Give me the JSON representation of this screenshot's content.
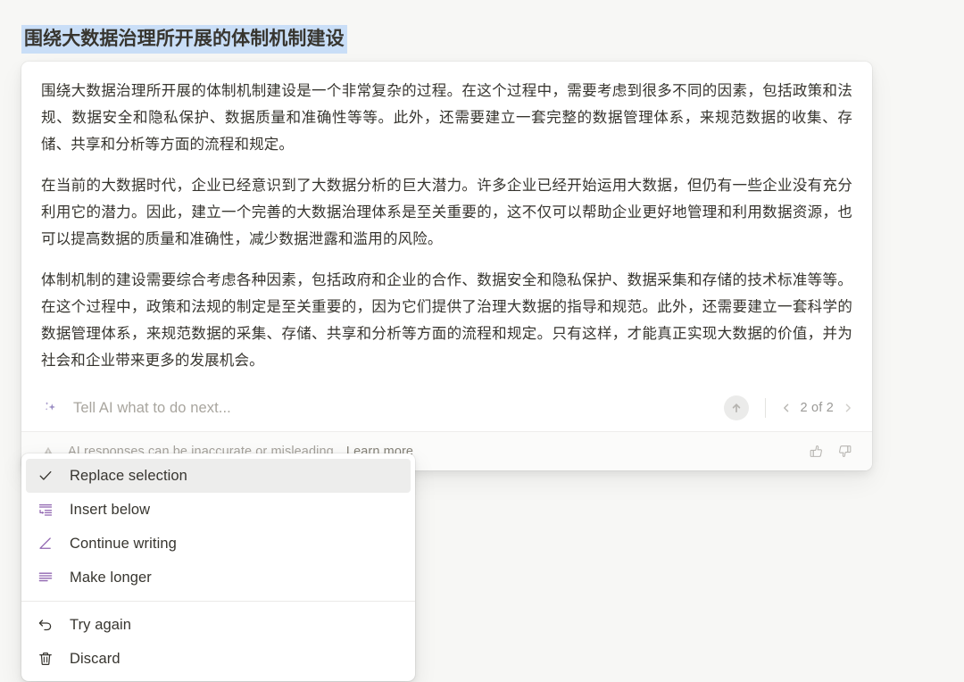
{
  "document": {
    "title": "围绕大数据治理所开展的体制机制建设",
    "title_selected": true,
    "selection_highlight_color": "#c9def7"
  },
  "ai_card": {
    "paragraphs": [
      "围绕大数据治理所开展的体制机制建设是一个非常复杂的过程。在这个过程中，需要考虑到很多不同的因素，包括政策和法规、数据安全和隐私保护、数据质量和准确性等等。此外，还需要建立一套完整的数据管理体系，来规范数据的收集、存储、共享和分析等方面的流程和规定。",
      "在当前的大数据时代，企业已经意识到了大数据分析的巨大潜力。许多企业已经开始运用大数据，但仍有一些企业没有充分利用它的潜力。因此，建立一个完善的大数据治理体系是至关重要的，这不仅可以帮助企业更好地管理和利用数据资源，也可以提高数据的质量和准确性，减少数据泄露和滥用的风险。",
      "体制机制的建设需要综合考虑各种因素，包括政府和企业的合作、数据安全和隐私保护、数据采集和存储的技术标准等等。在这个过程中，政策和法规的制定是至关重要的，因为它们提供了治理大数据的指导和规范。此外，还需要建立一套科学的数据管理体系，来规范数据的采集、存储、共享和分析等方面的流程和规定。只有这样，才能真正实现大数据的价值，并为社会和企业带来更多的发展机会。"
    ],
    "prompt_input": {
      "value": "",
      "placeholder": "Tell AI what to do next...",
      "icon": "sparkle-icon"
    },
    "submit_button": {
      "icon": "arrow-up-circle-icon",
      "label": ""
    },
    "pagination": {
      "prev_icon": "chevron-left-icon",
      "next_icon": "chevron-right-icon",
      "label": "2 of 2",
      "current": 2,
      "total": 2
    },
    "footer": {
      "icon": "warning-triangle-icon",
      "text": "AI responses can be inaccurate or misleading.",
      "link_label": "Learn more",
      "thumbs_up_icon": "thumbs-up-icon",
      "thumbs_down_icon": "thumbs-down-icon"
    }
  },
  "menu": {
    "primary_items": [
      {
        "label": "Replace selection",
        "icon": "check-icon",
        "selected": true,
        "icon_color": "#37352f"
      },
      {
        "label": "Insert below",
        "icon": "insert-below-icon",
        "selected": false,
        "icon_color": "#9065b0"
      },
      {
        "label": "Continue writing",
        "icon": "continue-writing-icon",
        "selected": false,
        "icon_color": "#9065b0"
      },
      {
        "label": "Make longer",
        "icon": "make-longer-icon",
        "selected": false,
        "icon_color": "#9065b0"
      }
    ],
    "secondary_items": [
      {
        "label": "Try again",
        "icon": "undo-arrow-icon",
        "icon_color": "#37352f"
      },
      {
        "label": "Discard",
        "icon": "trash-icon",
        "icon_color": "#37352f"
      }
    ]
  },
  "theme": {
    "page_background": "#f7f7f5",
    "card_background": "#ffffff",
    "text_primary": "#37352f",
    "text_muted": "#9b9a97",
    "accent_purple": "#9065b0",
    "selection_blue": "#c9def7",
    "hover_gray": "#ededec"
  }
}
